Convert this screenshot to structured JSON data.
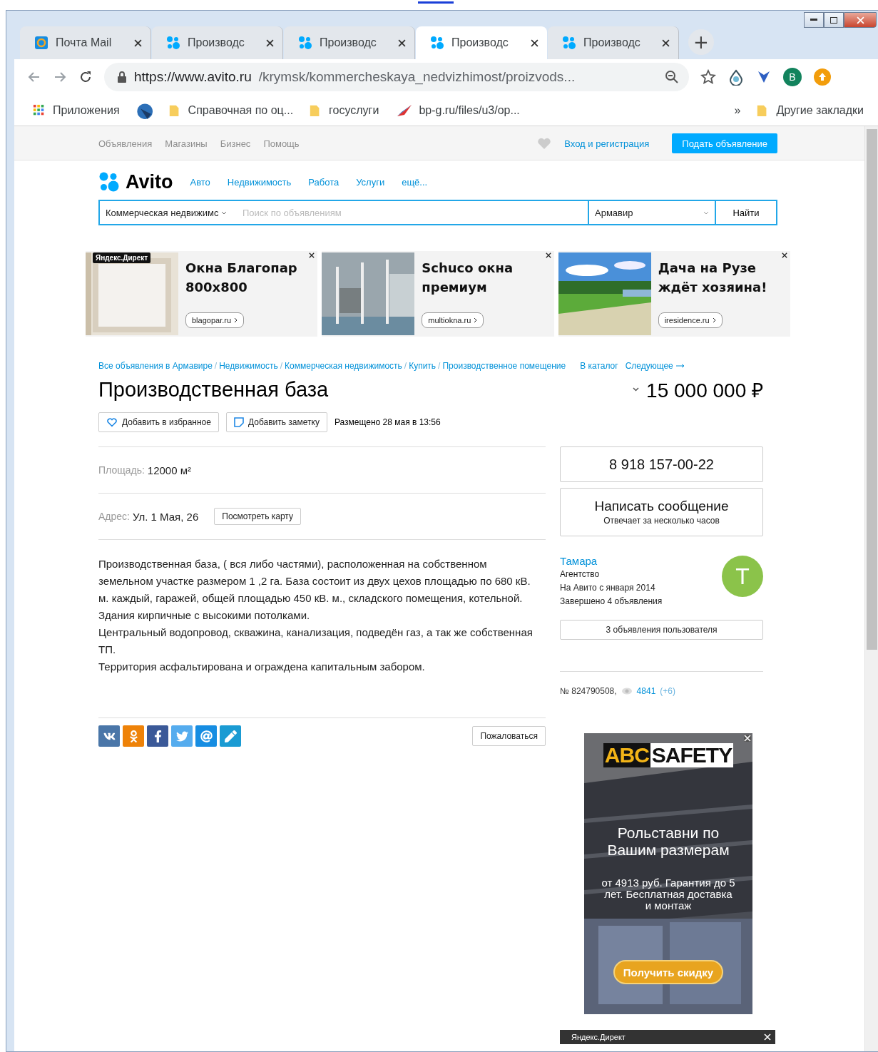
{
  "browser": {
    "tabs": [
      {
        "title": "Почта Mail",
        "kind": "mail",
        "selected": false
      },
      {
        "title": "Производс",
        "kind": "avito",
        "selected": false
      },
      {
        "title": "Производс",
        "kind": "avito",
        "selected": false
      },
      {
        "title": "Производс",
        "kind": "avito",
        "selected": true
      },
      {
        "title": "Производс",
        "kind": "avito",
        "selected": false
      }
    ],
    "new_tab": "+",
    "url_host": "https://www.avito.ru",
    "url_path": "/krymsk/kommercheskaya_nedvizhimost/proizvods...",
    "profile": "B",
    "bookmarks": [
      {
        "kind": "apps",
        "label": "Приложения"
      },
      {
        "kind": "site"
      },
      {
        "kind": "folder",
        "label": "Справочная по оц..."
      },
      {
        "kind": "folder",
        "label": "госуслуги"
      },
      {
        "kind": "link",
        "label": "bp-g.ru/files/u3/op..."
      }
    ],
    "overflow": "»",
    "other_bookmarks": "Другие закладки"
  },
  "site": {
    "topnav": [
      "Объявления",
      "Магазины",
      "Бизнес",
      "Помощь"
    ],
    "login": "Вход и регистрация",
    "post_button": "Подать объявление",
    "logo": "Avito",
    "categories": [
      "Авто",
      "Недвижимость",
      "Работа",
      "Услуги",
      "ещё..."
    ],
    "search": {
      "category": "Коммерческая недвижимс",
      "placeholder": "Поиск по объявлениям",
      "city": "Армавир",
      "button": "Найти"
    },
    "ads": [
      {
        "badge": "Яндекс.Директ",
        "title": "Окна Благопар 800x800",
        "domain": "blagopar.ru"
      },
      {
        "title": "Schuco окна премиум",
        "domain": "multiokna.ru"
      },
      {
        "title": "Дача на Рузе ждёт хозяина!",
        "domain": "iresidence.ru"
      }
    ],
    "breadcrumbs": [
      {
        "label": "Все объявления в Армавире"
      },
      {
        "separator": "/",
        "label": "Недвижимость"
      },
      {
        "separator": "/",
        "label": "Коммерческая недвижимость"
      },
      {
        "separator": "/",
        "label": "Купить"
      },
      {
        "separator": "/",
        "label": "Производственное помещение"
      }
    ],
    "catalog_link": "В каталог",
    "next_link": "Следующее",
    "title": "Производственная база",
    "price": "15 000 000 ₽",
    "favorite_button": "Добавить в избранное",
    "note_button": "Добавить заметку",
    "posted": "Размещено 28 мая в 13:56",
    "area": {
      "label": "Площадь:",
      "value": "12000 м²"
    },
    "address": {
      "label": "Адрес:",
      "value": "Ул. 1 Мая, 26",
      "map_button": "Посмотреть карту"
    },
    "description": [
      "Производственная база, ( вся либо частями), расположенная на собственном земельном участке размером 1 ,2 га. База состоит из двух цехов площадью по 680 кВ. м. каждый, гаражей, общей площадью 450 кВ. м., складского помещения, котельной.",
      "Здания кирпичные с высокими потолками.",
      "Центральный водопровод, скважина, канализация, подведён газ, а так же собственная ТП.",
      "Территория асфальтирована и ограждена капитальным забором."
    ],
    "share": [
      {
        "kind": "vk",
        "color": "#4a76a8"
      },
      {
        "kind": "ok",
        "color": "#ee8208"
      },
      {
        "kind": "fb",
        "color": "#3b5998"
      },
      {
        "kind": "tw",
        "color": "#55acee"
      },
      {
        "kind": "mail",
        "color": "#168de2"
      },
      {
        "kind": "lj",
        "color": "#1a9bd3"
      }
    ],
    "complain_button": "Пожаловаться",
    "phone": "8 918 157-00-22",
    "message": {
      "title": "Написать сообщение",
      "subtitle": "Отвечает за несколько часов"
    },
    "seller": {
      "name": "Тамара",
      "type": "Агентство",
      "since": "На Авито с января 2014",
      "completed": "Завершено 4 объявления",
      "avatar": "Т"
    },
    "user_ads_button": "3 объявления пользователя",
    "item_number": "№ 824790508,",
    "views": "4841",
    "views_new": "(+6)",
    "side_ad": {
      "brand_a": "ABC",
      "brand_b": "SAFETY",
      "headline": "Рольставни по Вашим размерам",
      "text": "от 4913 руб. Гарантия до 5 лет. Бесплатная доставка и монтаж",
      "button": "Получить скидку"
    },
    "bottom_ad": {
      "badge": "Яндекс.Директ"
    }
  }
}
